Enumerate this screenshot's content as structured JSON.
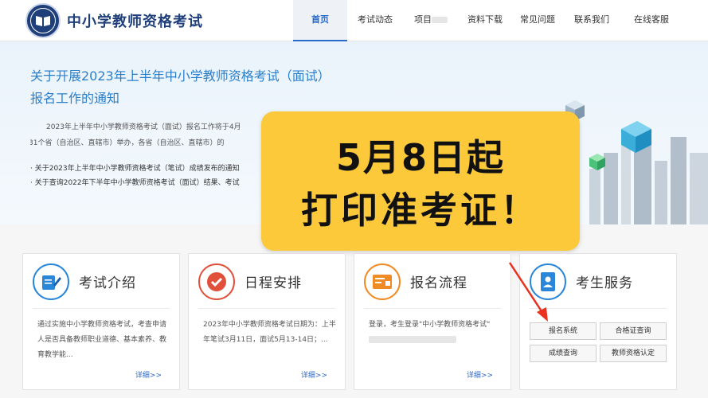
{
  "header": {
    "site_title": "中小学教师资格考试",
    "nav": [
      {
        "label": "首页",
        "active": true
      },
      {
        "label": "考试动态",
        "active": false
      },
      {
        "label": "项目",
        "active": false
      },
      {
        "label": "资料下载",
        "active": false
      },
      {
        "label": "常见问题",
        "active": false
      },
      {
        "label": "联系我们",
        "active": false
      },
      {
        "label": "在线客服",
        "active": false
      }
    ]
  },
  "banner": {
    "title": "关于开展2023年上半年中小学教师资格考试（面试）报名工作的通知",
    "text_line1": "2023年上半年中小学教师资格考试（面试）报名工作将于4月",
    "text_line2": "试在31个省（自治区、直辖市）举办，各省（自治区、直辖市）的",
    "link1": "· 关于2023年上半年中小学教师资格考试（笔试）成绩发布的通知",
    "link2": "· 关于查询2022年下半年中小学教师资格考试（面试）结果、考试"
  },
  "overlay": {
    "line1": "5月8日起",
    "line2": "打印准考证！"
  },
  "cards": [
    {
      "title": "考试介绍",
      "text": "通过实施中小学教师资格考试，考查申请人是否具备教师职业道德、基本素养、教育教学能...",
      "more": "详细>>",
      "icon": "document-pen-icon",
      "color": "#2a86d8"
    },
    {
      "title": "日程安排",
      "text": "2023年中小学教师资格考试日期为：上半年笔试3月11日，面试5月13-14日；...",
      "more": "详细>>",
      "icon": "checkmark-icon",
      "color": "#e0503a"
    },
    {
      "title": "报名流程",
      "text": "登录，考生登录\"中小学教师资格考试\"",
      "more": "详细>>",
      "icon": "form-icon",
      "color": "#f08a24"
    },
    {
      "title": "考生服务",
      "icon": "contact-book-icon",
      "color": "#2a86d8"
    }
  ],
  "services": {
    "buttons": [
      "报名系统",
      "合格证查询",
      "成绩查询",
      "教师资格认定"
    ]
  },
  "colors": {
    "brand": "#1f3f7a",
    "accent": "#2a6bc7",
    "overlay_bg": "#fcc93b",
    "arrow": "#e8321f"
  }
}
